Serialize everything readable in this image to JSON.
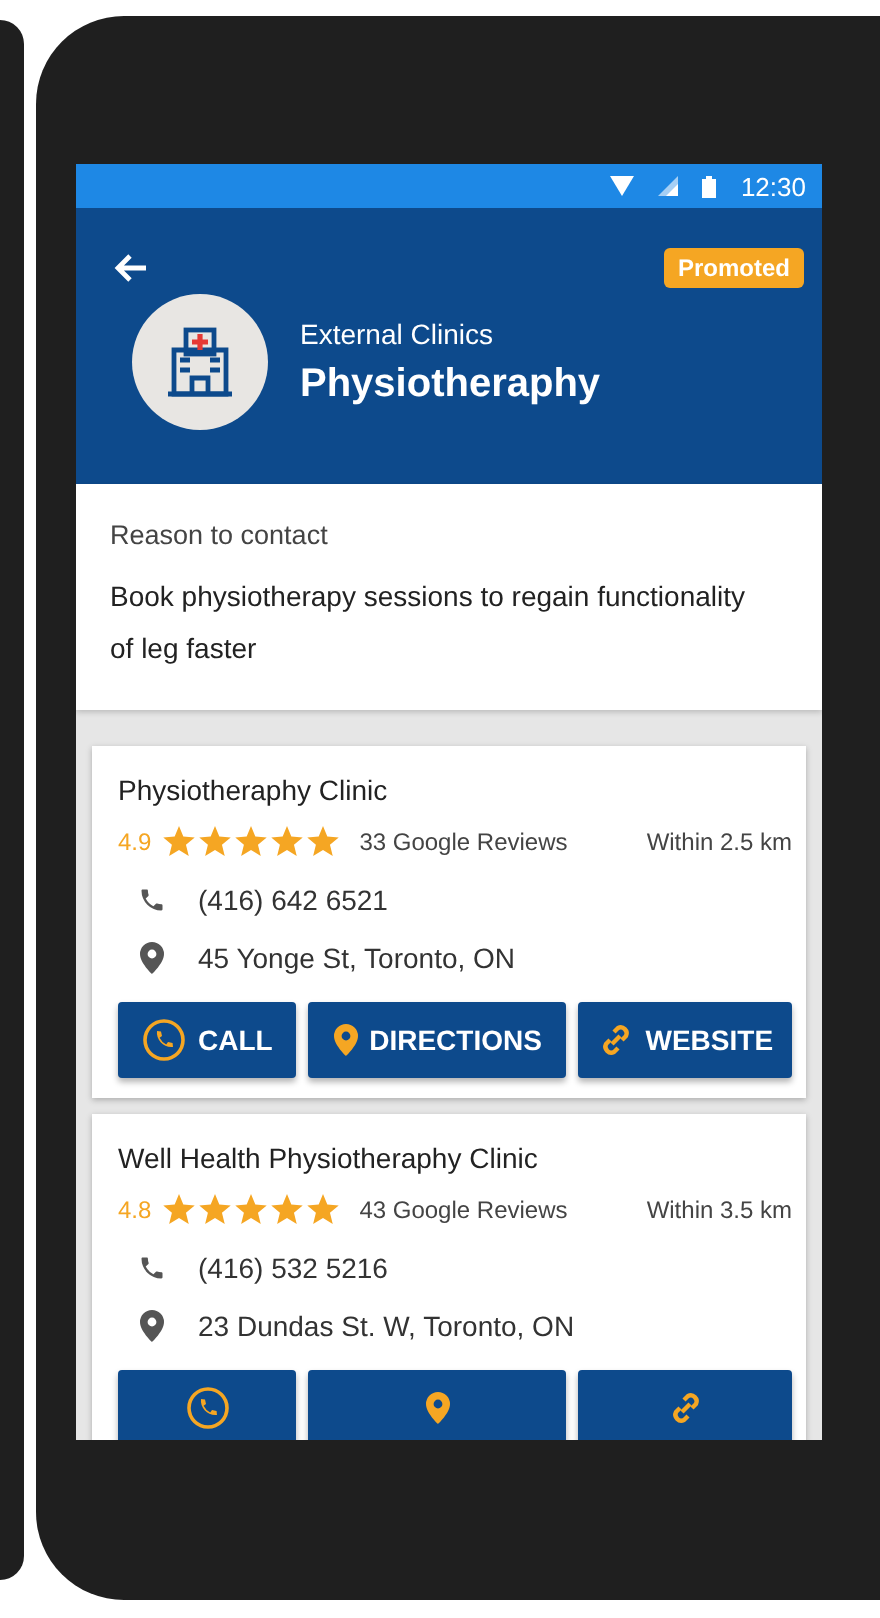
{
  "status_bar": {
    "time": "12:30"
  },
  "header": {
    "badge": "Promoted",
    "category": "External Clinics",
    "title": "Physiotheraphy"
  },
  "reason": {
    "label": "Reason to contact",
    "text": "Book physiotherapy sessions to regain functionality of leg faster"
  },
  "clinics": [
    {
      "name": "Physiotheraphy Clinic",
      "rating": "4.9",
      "stars": 5,
      "reviews": "33 Google Reviews",
      "distance": "Within 2.5 km",
      "phone": "(416) 642 6521",
      "address": "45 Yonge St, Toronto, ON",
      "actions": [
        {
          "kind": "call",
          "label": "CALL"
        },
        {
          "kind": "directions",
          "label": "DIRECTIONS"
        },
        {
          "kind": "website",
          "label": "WEBSITE"
        }
      ]
    },
    {
      "name": "Well Health Physiotheraphy Clinic",
      "rating": "4.8",
      "stars": 5,
      "reviews": "43 Google Reviews",
      "distance": "Within 3.5 km",
      "phone": "(416) 532 5216",
      "address": "23 Dundas St. W, Toronto, ON",
      "actions": [
        {
          "kind": "call"
        },
        {
          "kind": "directions"
        },
        {
          "kind": "website"
        }
      ]
    }
  ]
}
